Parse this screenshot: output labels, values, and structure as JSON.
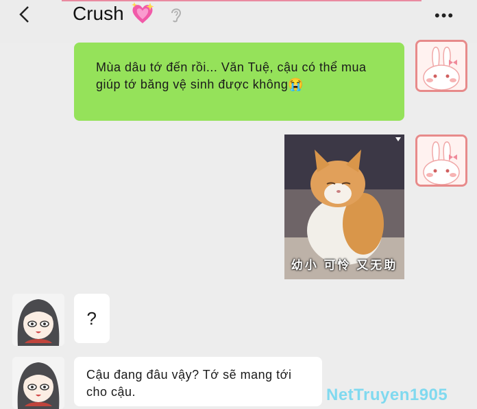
{
  "header": {
    "title": "Crush",
    "more": "•••"
  },
  "messages": {
    "outgoing_text": "Mùa dâu tớ đến rồi... Văn Tuệ, cậu có thể mua giúp tớ băng vệ sinh được không😭",
    "sticker_caption": "幼小 可怜 又无助",
    "incoming_1": "?",
    "incoming_2": "Cậu đang đâu vậy? Tớ sẽ mang tới cho cậu."
  },
  "watermark": "NetTruyen1905",
  "colors": {
    "outgoing_bubble": "#95e25a",
    "incoming_bubble": "#ffffff",
    "background": "#ededed",
    "bunny_border": "#e78a8a"
  },
  "icons": [
    "back-arrow-icon",
    "sparkling-heart-icon",
    "ear-icon",
    "more-icon"
  ]
}
